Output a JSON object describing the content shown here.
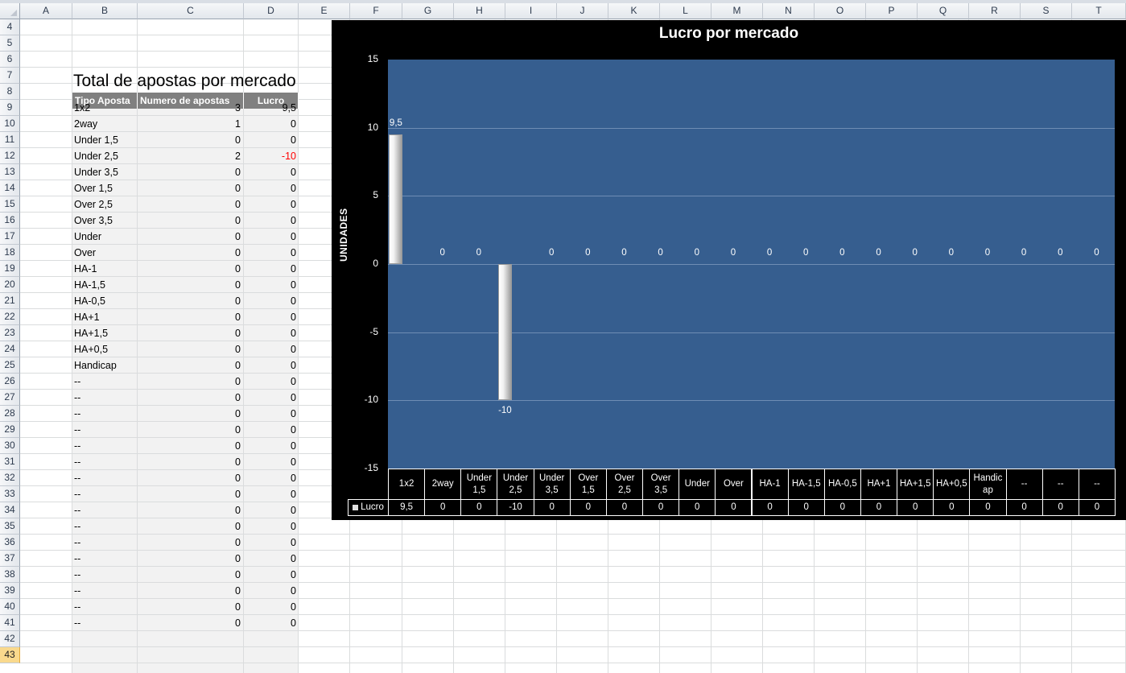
{
  "sheet": {
    "columns": [
      "A",
      "B",
      "C",
      "D",
      "E",
      "F",
      "G",
      "H",
      "I",
      "J",
      "K",
      "L",
      "M",
      "N",
      "O",
      "P",
      "Q",
      "R",
      "S",
      "T"
    ],
    "rows": [
      "4",
      "5",
      "6",
      "7",
      "8",
      "9",
      "10",
      "11",
      "12",
      "13",
      "14",
      "15",
      "16",
      "17",
      "18",
      "19",
      "20",
      "21",
      "22",
      "23",
      "24",
      "25",
      "26",
      "27",
      "28",
      "29",
      "30",
      "31",
      "32",
      "33",
      "34",
      "35",
      "36",
      "37",
      "38",
      "39",
      "40",
      "41",
      "42",
      "43"
    ],
    "active_row": "43"
  },
  "table": {
    "title": "Total de apostas por mercado",
    "headers": [
      "Tipo Aposta",
      "Numero de apostas",
      "Lucro"
    ],
    "rows": [
      [
        "1x2",
        "3",
        "9,5"
      ],
      [
        "2way",
        "1",
        "0"
      ],
      [
        "Under 1,5",
        "0",
        "0"
      ],
      [
        "Under 2,5",
        "2",
        "-10"
      ],
      [
        "Under 3,5",
        "0",
        "0"
      ],
      [
        "Over 1,5",
        "0",
        "0"
      ],
      [
        "Over 2,5",
        "0",
        "0"
      ],
      [
        "Over 3,5",
        "0",
        "0"
      ],
      [
        "Under",
        "0",
        "0"
      ],
      [
        "Over",
        "0",
        "0"
      ],
      [
        "HA-1",
        "0",
        "0"
      ],
      [
        "HA-1,5",
        "0",
        "0"
      ],
      [
        "HA-0,5",
        "0",
        "0"
      ],
      [
        "HA+1",
        "0",
        "0"
      ],
      [
        "HA+1,5",
        "0",
        "0"
      ],
      [
        "HA+0,5",
        "0",
        "0"
      ],
      [
        "Handicap",
        "0",
        "0"
      ],
      [
        "--",
        "0",
        "0"
      ],
      [
        "--",
        "0",
        "0"
      ],
      [
        "--",
        "0",
        "0"
      ],
      [
        "--",
        "0",
        "0"
      ],
      [
        "--",
        "0",
        "0"
      ],
      [
        "--",
        "0",
        "0"
      ],
      [
        "--",
        "0",
        "0"
      ],
      [
        "--",
        "0",
        "0"
      ],
      [
        "--",
        "0",
        "0"
      ],
      [
        "--",
        "0",
        "0"
      ],
      [
        "--",
        "0",
        "0"
      ],
      [
        "--",
        "0",
        "0"
      ],
      [
        "--",
        "0",
        "0"
      ],
      [
        "--",
        "0",
        "0"
      ],
      [
        "--",
        "0",
        "0"
      ],
      [
        "--",
        "0",
        "0"
      ]
    ],
    "negative_color": "#ff0000"
  },
  "chart_data": {
    "type": "bar",
    "title": "Lucro por mercado",
    "ylabel": "UNIDADES",
    "xlabel": "",
    "ylim": [
      -15,
      15
    ],
    "yticks": [
      "15",
      "10",
      "5",
      "0",
      "-5",
      "-10",
      "-15"
    ],
    "categories": [
      "1x2",
      "2way",
      "Under 1,5",
      "Under 2,5",
      "Under 3,5",
      "Over 1,5",
      "Over 2,5",
      "Over 3,5",
      "Under",
      "Over",
      "HA-1",
      "HA-1,5",
      "HA-0,5",
      "HA+1",
      "HA+1,5",
      "HA+0,5",
      "Handicap",
      "--",
      "--",
      "--"
    ],
    "category_display": [
      "1x2",
      "2way",
      "Under\n1,5",
      "Under\n2,5",
      "Under\n3,5",
      "Over\n1,5",
      "Over\n2,5",
      "Over\n3,5",
      "Under",
      "Over",
      "HA-1",
      "HA-1,5",
      "HA-0,5",
      "HA+1",
      "HA+1,5",
      "HA+0,5",
      "Handic\nap",
      "--",
      "--",
      "--"
    ],
    "series": [
      {
        "name": "Lucro",
        "values": [
          9.5,
          0,
          0,
          -10,
          0,
          0,
          0,
          0,
          0,
          0,
          0,
          0,
          0,
          0,
          0,
          0,
          0,
          0,
          0,
          0
        ],
        "labels": [
          "9,5",
          "0",
          "0",
          "-10",
          "0",
          "0",
          "0",
          "0",
          "0",
          "0",
          "0",
          "0",
          "0",
          "0",
          "0",
          "0",
          "0",
          "0",
          "0",
          "0"
        ]
      }
    ],
    "grid": true,
    "legend": "data-table",
    "colors": {
      "background": "#000000",
      "plot": "#365e8f",
      "gridline": "#6f8db4",
      "bar": "#e6e6e6"
    }
  }
}
